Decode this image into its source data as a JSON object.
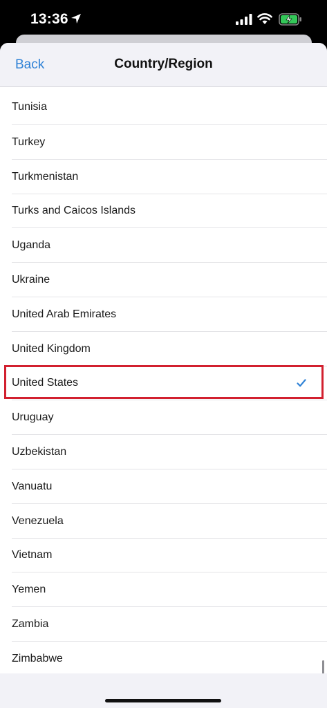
{
  "status_bar": {
    "time": "13:36",
    "icons": [
      "location-arrow-icon",
      "cellular-signal-icon",
      "wifi-icon",
      "battery-charging-icon"
    ],
    "battery_color": "#34c759"
  },
  "nav": {
    "back_label": "Back",
    "title": "Country/Region"
  },
  "colors": {
    "accent": "#2f82d6",
    "highlight": "#d2202f"
  },
  "countries": [
    {
      "name": "Tunisia",
      "selected": false
    },
    {
      "name": "Turkey",
      "selected": false
    },
    {
      "name": "Turkmenistan",
      "selected": false
    },
    {
      "name": "Turks and Caicos Islands",
      "selected": false
    },
    {
      "name": "Uganda",
      "selected": false
    },
    {
      "name": "Ukraine",
      "selected": false
    },
    {
      "name": "United Arab Emirates",
      "selected": false
    },
    {
      "name": "United Kingdom",
      "selected": false
    },
    {
      "name": "United States",
      "selected": true
    },
    {
      "name": "Uruguay",
      "selected": false
    },
    {
      "name": "Uzbekistan",
      "selected": false
    },
    {
      "name": "Vanuatu",
      "selected": false
    },
    {
      "name": "Venezuela",
      "selected": false
    },
    {
      "name": "Vietnam",
      "selected": false
    },
    {
      "name": "Yemen",
      "selected": false
    },
    {
      "name": "Zambia",
      "selected": false
    },
    {
      "name": "Zimbabwe",
      "selected": false
    }
  ]
}
